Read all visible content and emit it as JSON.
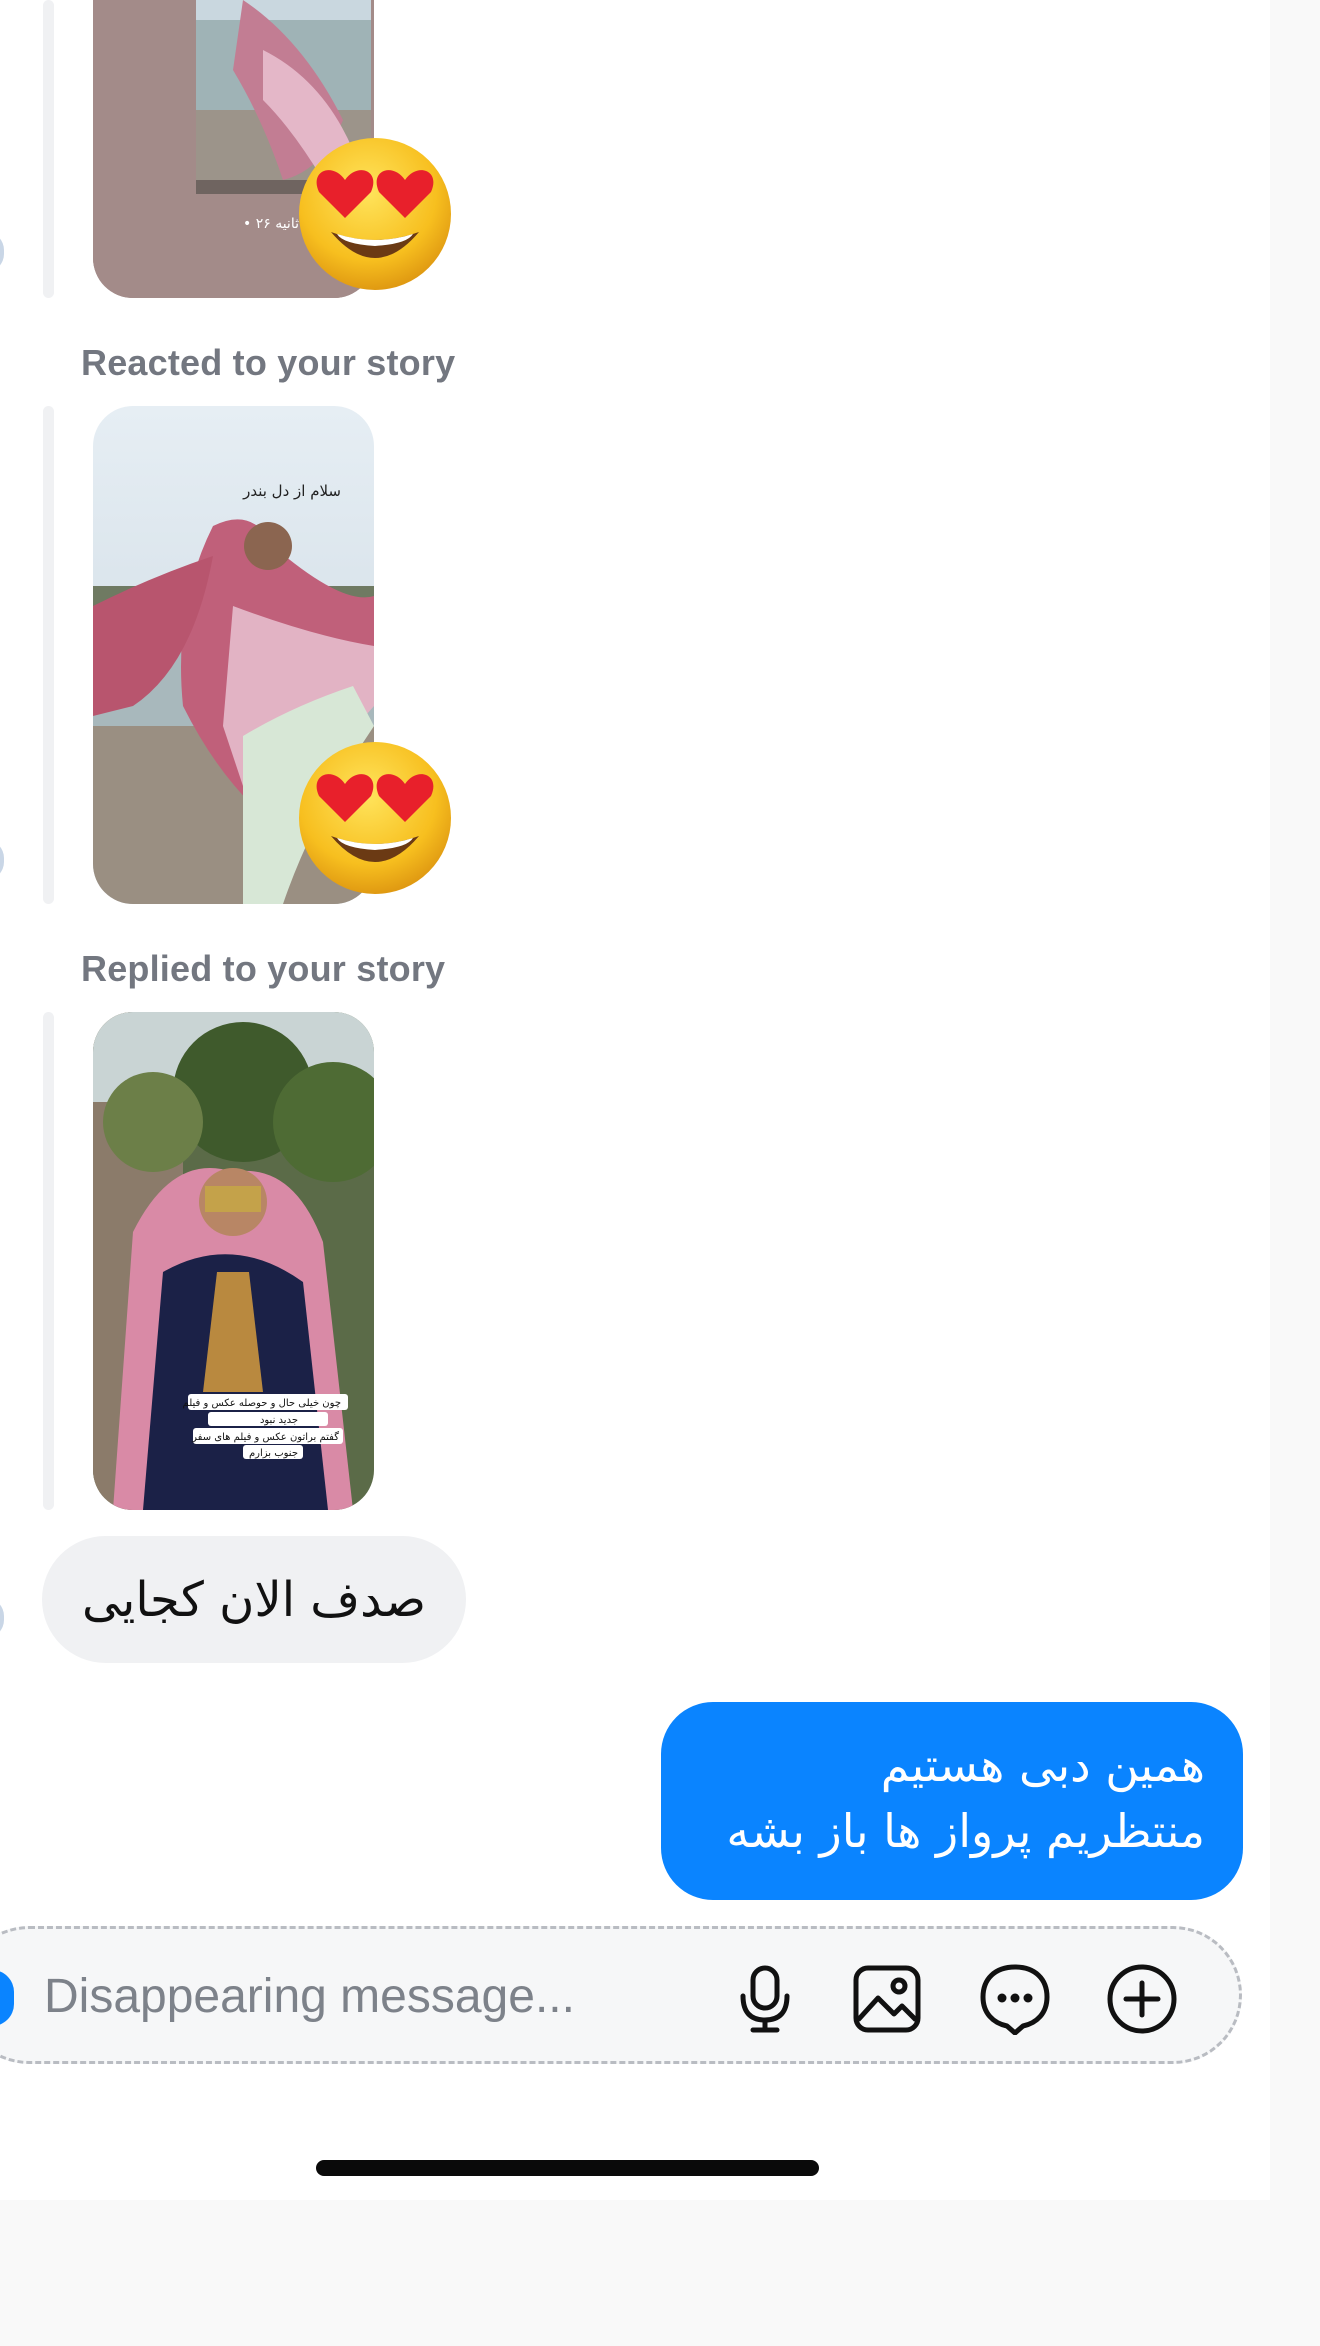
{
  "thread": {
    "reacted_label": "Reacted to your story",
    "replied_label": "Replied to your story"
  },
  "stories": [
    {
      "caption": "سلام از دل بندر",
      "reaction": "heart-eyes-emoji"
    },
    {
      "caption_lines": [
        "چون خیلی حال و حوصله عکس و فیلم",
        "جدید نبود",
        "گفتم براتون عکس و فیلم های سفر",
        "جنوب بزارم"
      ]
    }
  ],
  "messages": {
    "incoming": "صدف الان کجایی",
    "outgoing_lines": [
      "همین دبی هستیم",
      "منتظریم پرواز ها باز بشه"
    ]
  },
  "composer": {
    "placeholder": "Disappearing message...",
    "icons": [
      "microphone-icon",
      "gallery-icon",
      "sticker-chat-icon",
      "plus-icon"
    ]
  },
  "colors": {
    "accent": "#0a84ff",
    "bubble_in": "#f0f1f3",
    "label": "#737780"
  }
}
